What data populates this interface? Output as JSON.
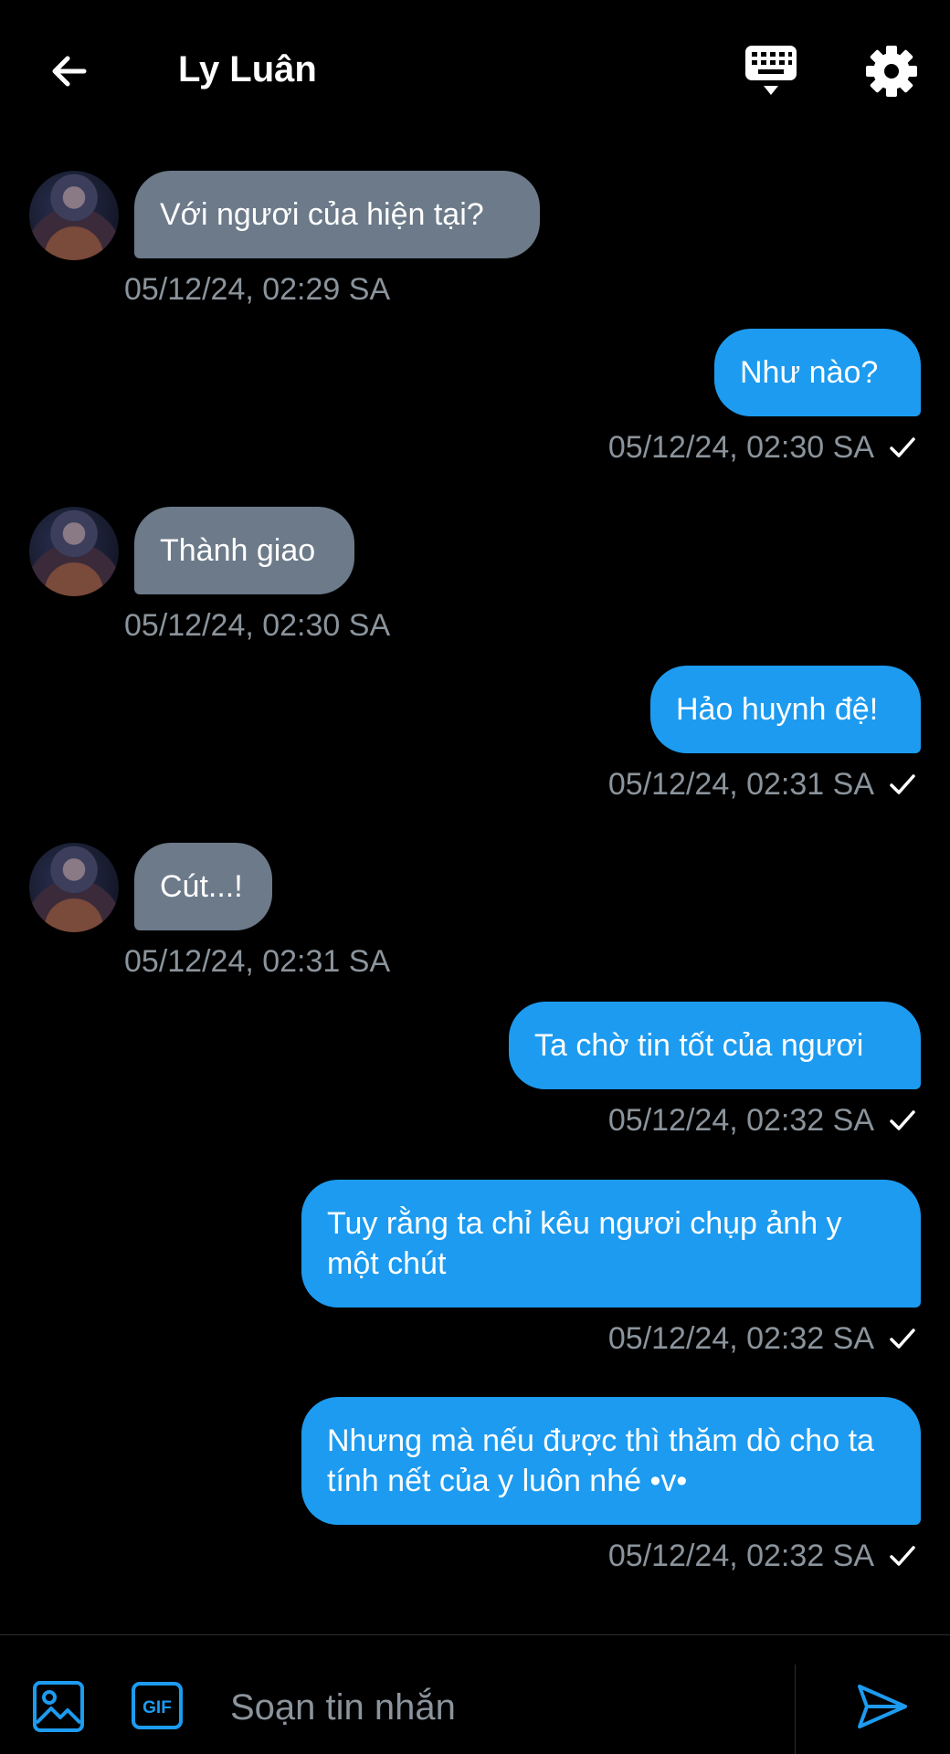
{
  "header": {
    "title": "Ly Luân",
    "back_icon": "arrow-left-icon",
    "keyboard_icon": "keyboard-icon",
    "settings_icon": "gear-icon"
  },
  "messages": [
    {
      "dir": "in",
      "text": "Với ngươi của hiện tại?",
      "time": "05/12/24, 02:29 SA"
    },
    {
      "dir": "out",
      "text": "Như nào?",
      "time": "05/12/24, 02:30 SA"
    },
    {
      "dir": "in",
      "text": "Thành giao",
      "time": "05/12/24, 02:30 SA"
    },
    {
      "dir": "out",
      "text": "Hảo huynh đệ!",
      "time": "05/12/24, 02:31 SA"
    },
    {
      "dir": "in",
      "text": "Cút...!",
      "time": "05/12/24, 02:31 SA"
    },
    {
      "dir": "out",
      "text": "Ta chờ tin tốt của ngươi",
      "time": "05/12/24, 02:32 SA"
    },
    {
      "dir": "out",
      "text": "Tuy rằng ta chỉ kêu ngươi chụp ảnh y một chút",
      "time": "05/12/24, 02:32 SA"
    },
    {
      "dir": "out",
      "text": "Nhưng mà nếu được thì thăm dò cho ta tính nết của y luôn nhé •v•",
      "time": "05/12/24, 02:32 SA"
    }
  ],
  "composer": {
    "placeholder": "Soạn tin nhắn",
    "gif_label": "GIF"
  },
  "colors": {
    "background": "#000000",
    "incoming_bubble": "#6c7a89",
    "outgoing_bubble": "#1d9bf0",
    "timestamp": "#8b949c"
  }
}
